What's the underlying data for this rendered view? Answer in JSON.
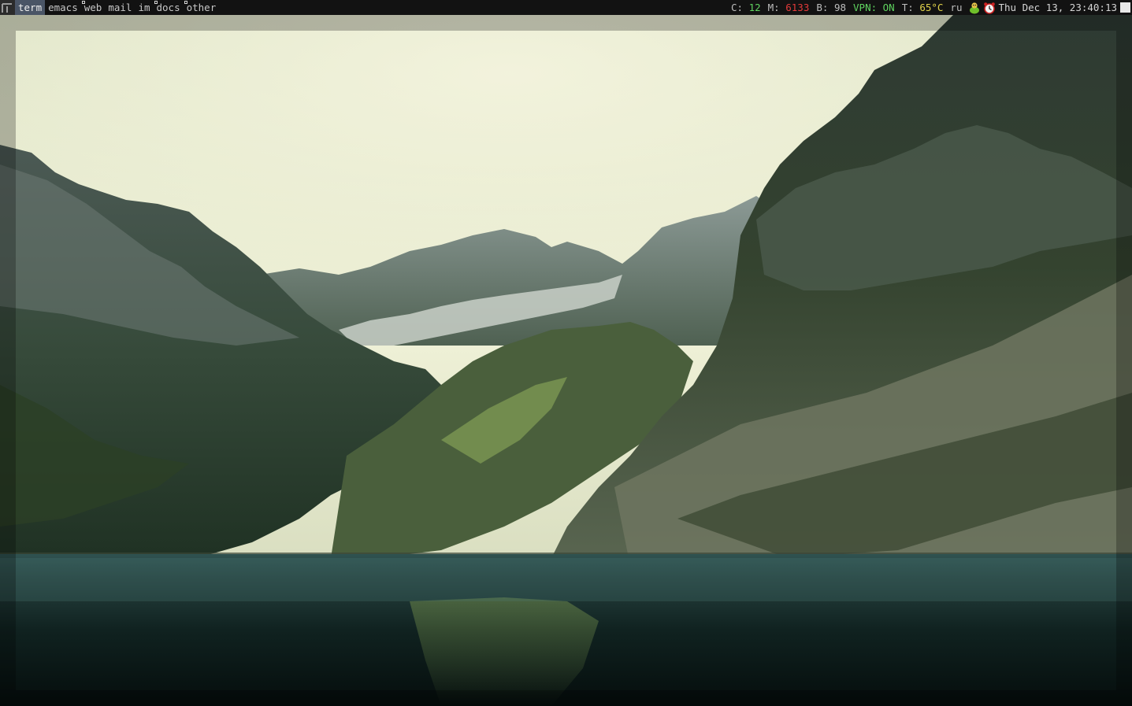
{
  "tags": [
    {
      "label": "term",
      "active": true,
      "has_client": false
    },
    {
      "label": "emacs",
      "active": false,
      "has_client": false
    },
    {
      "label": "web",
      "active": false,
      "has_client": true
    },
    {
      "label": "mail",
      "active": false,
      "has_client": false
    },
    {
      "label": "im",
      "active": false,
      "has_client": false
    },
    {
      "label": "docs",
      "active": false,
      "has_client": true
    },
    {
      "label": "other",
      "active": false,
      "has_client": true
    }
  ],
  "status": {
    "cpu_label": "C:",
    "cpu_value": "12",
    "mem_label": "M:",
    "mem_value": "6133",
    "bat_label": "B:",
    "bat_value": "98",
    "vpn_label": "VPN:",
    "vpn_value": "ON",
    "temp_label": "T:",
    "temp_value": "65°C",
    "kbd_layout": "ru",
    "clock": "Thu Dec 13, 23:40:13"
  },
  "icons": {
    "layout": "layout-tile-icon",
    "tray_1": "pidgin-icon",
    "tray_2": "alarm-clock-icon"
  },
  "colors": {
    "bar_bg": "#121212",
    "active_tag_bg": "#4a5566",
    "ok_green": "#5fd35f",
    "alert_red": "#e23a3a",
    "warn_yellow": "#e0d14a"
  }
}
